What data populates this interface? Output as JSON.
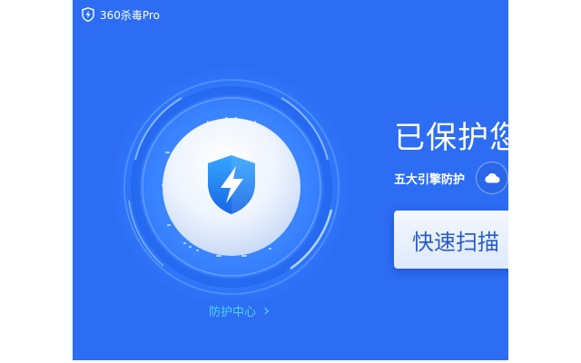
{
  "window": {
    "title": "360杀毒Pro",
    "logo_icon": "shield-bolt-icon"
  },
  "dial": {
    "center_icon": "shield-bolt-icon"
  },
  "protection_center": {
    "label": "防护中心",
    "chevron": "›"
  },
  "status": {
    "title": "已保护您"
  },
  "engines": {
    "label": "五大引擎防护",
    "icon": "cloud-icon"
  },
  "scan": {
    "quick_scan_label": "快速扫描"
  },
  "colors": {
    "background": "#2d6df3",
    "accent_cyan": "#4cd6ff",
    "shield_blue": "#1f7cf0"
  }
}
